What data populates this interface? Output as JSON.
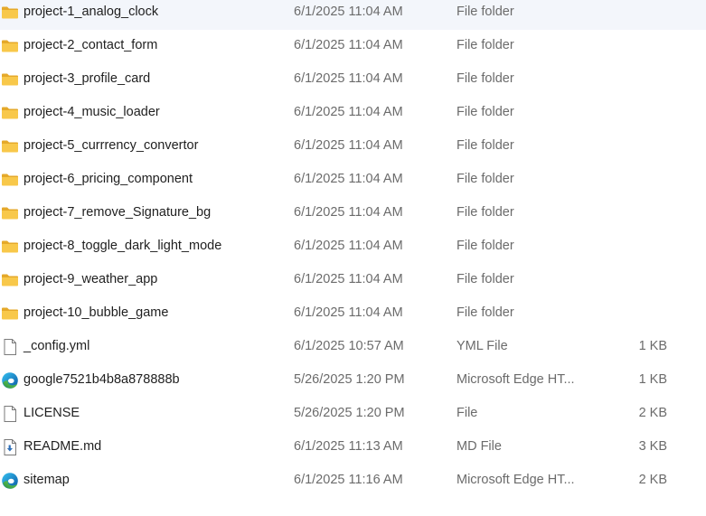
{
  "files": [
    {
      "name": "project-1_analog_clock",
      "date": "6/1/2025 11:04 AM",
      "type": "File folder",
      "size": "",
      "icon": "folder-icon"
    },
    {
      "name": "project-2_contact_form",
      "date": "6/1/2025 11:04 AM",
      "type": "File folder",
      "size": "",
      "icon": "folder-icon"
    },
    {
      "name": "project-3_profile_card",
      "date": "6/1/2025 11:04 AM",
      "type": "File folder",
      "size": "",
      "icon": "folder-icon"
    },
    {
      "name": "project-4_music_loader",
      "date": "6/1/2025 11:04 AM",
      "type": "File folder",
      "size": "",
      "icon": "folder-icon"
    },
    {
      "name": "project-5_currrency_convertor",
      "date": "6/1/2025 11:04 AM",
      "type": "File folder",
      "size": "",
      "icon": "folder-icon"
    },
    {
      "name": "project-6_pricing_component",
      "date": "6/1/2025 11:04 AM",
      "type": "File folder",
      "size": "",
      "icon": "folder-icon"
    },
    {
      "name": "project-7_remove_Signature_bg",
      "date": "6/1/2025 11:04 AM",
      "type": "File folder",
      "size": "",
      "icon": "folder-icon"
    },
    {
      "name": "project-8_toggle_dark_light_mode",
      "date": "6/1/2025 11:04 AM",
      "type": "File folder",
      "size": "",
      "icon": "folder-icon"
    },
    {
      "name": "project-9_weather_app",
      "date": "6/1/2025 11:04 AM",
      "type": "File folder",
      "size": "",
      "icon": "folder-icon"
    },
    {
      "name": "project-10_bubble_game",
      "date": "6/1/2025 11:04 AM",
      "type": "File folder",
      "size": "",
      "icon": "folder-icon"
    },
    {
      "name": "_config.yml",
      "date": "6/1/2025 10:57 AM",
      "type": "YML File",
      "size": "1 KB",
      "icon": "generic-file-icon"
    },
    {
      "name": "google7521b4b8a878888b",
      "date": "5/26/2025 1:20 PM",
      "type": "Microsoft Edge HT...",
      "size": "1 KB",
      "icon": "edge-html-icon"
    },
    {
      "name": "LICENSE",
      "date": "5/26/2025 1:20 PM",
      "type": "File",
      "size": "2 KB",
      "icon": "generic-file-icon"
    },
    {
      "name": "README.md",
      "date": "6/1/2025 11:13 AM",
      "type": "MD File",
      "size": "3 KB",
      "icon": "markdown-file-icon"
    },
    {
      "name": "sitemap",
      "date": "6/1/2025 11:16 AM",
      "type": "Microsoft Edge HT...",
      "size": "2 KB",
      "icon": "edge-html-icon"
    }
  ],
  "colors": {
    "folder_yellow": "#f8c84a",
    "folder_tab": "#e5a92a",
    "edge_blue": "#0c6ec9",
    "edge_green": "#3fc46b",
    "text_primary": "#1f1f1f",
    "text_secondary": "#6b6b6b"
  }
}
